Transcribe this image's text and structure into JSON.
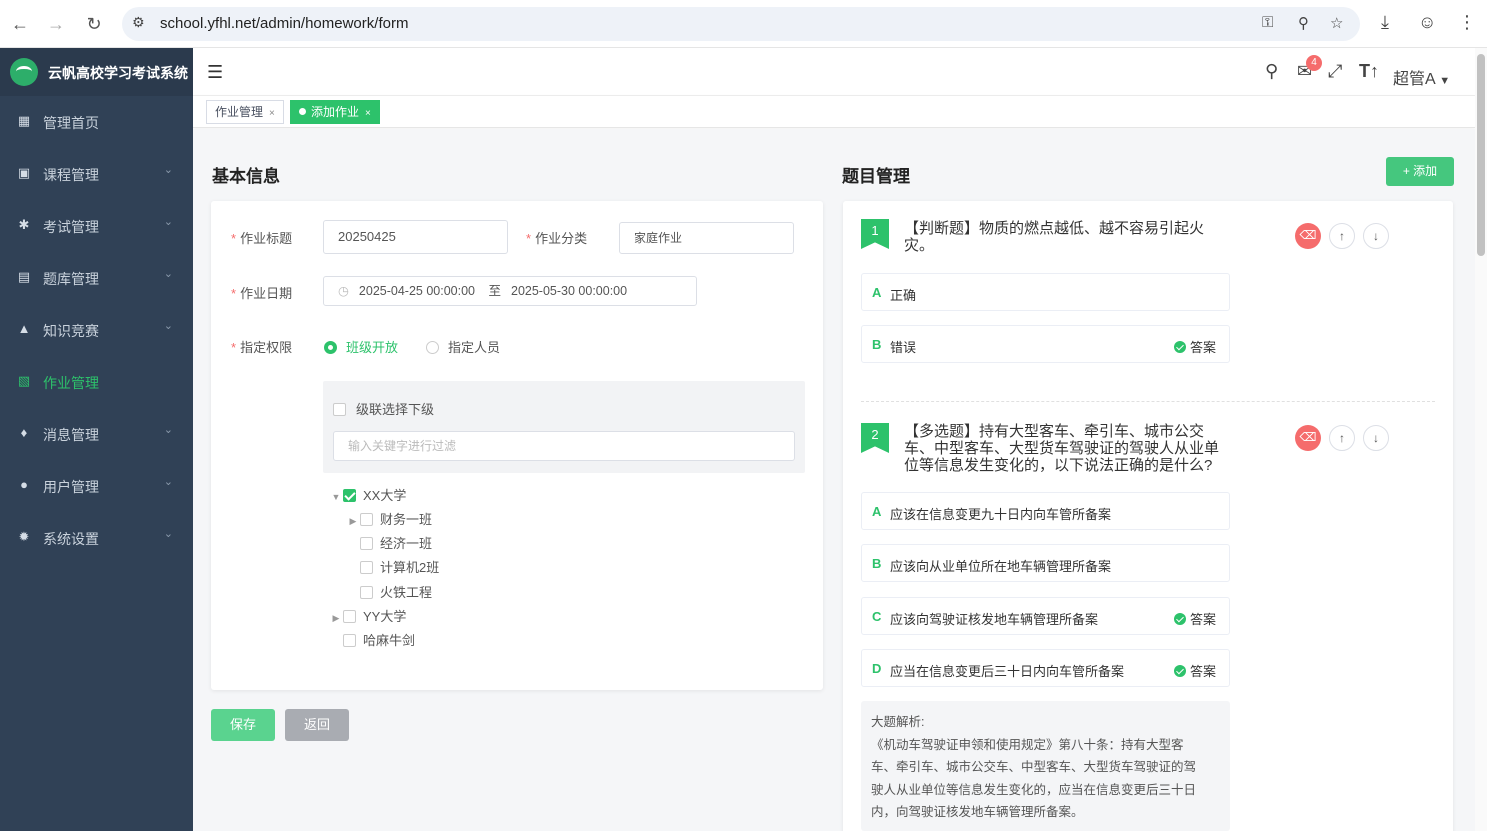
{
  "browser": {
    "url": "school.yfhl.net/admin/homework/form"
  },
  "app": {
    "title": "云帆高校学习考试系统",
    "user": "超管A",
    "notification_count": "4"
  },
  "sidebar": {
    "items": [
      {
        "label": "管理首页",
        "icon": "dashboard-icon"
      },
      {
        "label": "课程管理",
        "icon": "monitor-icon"
      },
      {
        "label": "考试管理",
        "icon": "gear-icon"
      },
      {
        "label": "题库管理",
        "icon": "document-icon"
      },
      {
        "label": "知识竞赛",
        "icon": "fire-icon"
      },
      {
        "label": "作业管理",
        "icon": "book-icon"
      },
      {
        "label": "消息管理",
        "icon": "bell-icon"
      },
      {
        "label": "用户管理",
        "icon": "user-icon"
      },
      {
        "label": "系统设置",
        "icon": "settings-icon"
      }
    ],
    "active": "作业管理"
  },
  "tags": [
    {
      "label": "作业管理"
    },
    {
      "label": "添加作业"
    }
  ],
  "basic": {
    "section_title": "基本信息",
    "title_label": "作业标题",
    "title_value": "20250425",
    "category_label": "作业分类",
    "category_value": "家庭作业",
    "date_label": "作业日期",
    "date_start": "2025-04-25 00:00:00",
    "date_sep": "至",
    "date_end": "2025-05-30 00:00:00",
    "perm_label": "指定权限",
    "perm_options": [
      "班级开放",
      "指定人员"
    ],
    "cascade_label": "级联选择下级",
    "filter_placeholder": "输入关键字进行过滤",
    "tree": [
      "XX大学",
      "财务一班",
      "经济一班",
      "计算机2班",
      "火铁工程",
      "YY大学",
      "哈麻牛剑"
    ],
    "save": "保存",
    "back": "返回"
  },
  "questions": {
    "section_title": "题目管理",
    "add": "+ 添加",
    "answer_label": "答案",
    "items": [
      {
        "num": "1",
        "text_line1": "【判断题】物质的燃点越低、越不容易引起火",
        "text_line2": "灾。",
        "options": [
          {
            "letter": "A",
            "text": "正确",
            "answer": false
          },
          {
            "letter": "B",
            "text": "错误",
            "answer": true
          }
        ]
      },
      {
        "num": "2",
        "text_line1": "【多选题】持有大型客车、牵引车、城市公交",
        "text_line2": "车、中型客车、大型货车驾驶证的驾驶人从业单",
        "text_line3": "位等信息发生变化的，以下说法正确的是什么?",
        "options": [
          {
            "letter": "A",
            "text": "应该在信息变更九十日内向车管所备案",
            "answer": false
          },
          {
            "letter": "B",
            "text": "应该向从业单位所在地车辆管理所备案",
            "answer": false
          },
          {
            "letter": "C",
            "text": "应该向驾驶证核发地车辆管理所备案",
            "answer": true
          },
          {
            "letter": "D",
            "text": "应当在信息变更后三十日内向车管所备案",
            "answer": true
          }
        ]
      }
    ],
    "analysis_title": "大题解析:",
    "analysis_lines": [
      "《机动车驾驶证申领和使用规定》第八十条：持有大型客",
      "车、牵引车、城市公交车、中型客车、大型货车驾驶证的驾",
      "驶人从业单位等信息发生变化的，应当在信息变更后三十日",
      "内，向驾驶证核发地车辆管理所备案。"
    ]
  }
}
